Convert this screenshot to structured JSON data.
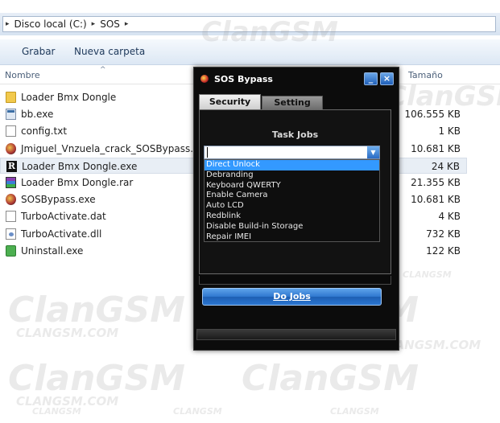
{
  "explorer": {
    "breadcrumb": [
      "Disco local (C:)",
      "SOS"
    ],
    "toolbar": {
      "burn_label": "Grabar",
      "new_folder_label": "Nueva carpeta"
    },
    "columns": {
      "name": "Nombre",
      "size": "Tamaño"
    },
    "files": [
      {
        "name": "Loader Bmx Dongle",
        "size": "",
        "icon": "folder-icon"
      },
      {
        "name": "bb.exe",
        "size": "106.555 KB",
        "icon": "app-icon"
      },
      {
        "name": "config.txt",
        "size": "1 KB",
        "icon": "text-file-icon"
      },
      {
        "name": "Jmiguel_Vnzuela_crack_SOSBypass.exe",
        "size": "10.681 KB",
        "icon": "sosbypass-icon"
      },
      {
        "name": "Loader Bmx Dongle.exe",
        "size": "24 KB",
        "icon": "loader-r-icon"
      },
      {
        "name": "Loader Bmx Dongle.rar",
        "size": "21.355 KB",
        "icon": "rar-archive-icon"
      },
      {
        "name": "SOSBypass.exe",
        "size": "10.681 KB",
        "icon": "sosbypass-icon"
      },
      {
        "name": "TurboActivate.dat",
        "size": "4 KB",
        "icon": "data-file-icon"
      },
      {
        "name": "TurboActivate.dll",
        "size": "732 KB",
        "icon": "dll-file-icon"
      },
      {
        "name": "Uninstall.exe",
        "size": "122 KB",
        "icon": "uninstall-icon"
      }
    ],
    "selected_index": 4
  },
  "watermark": {
    "big": "ClanGSM",
    "small": "CLANGSM.COM",
    "tiny": "CLANGSM"
  },
  "dialog": {
    "title": "SOS Bypass",
    "minimize_glyph": "_",
    "close_glyph": "×",
    "tabs": [
      {
        "label": "Security",
        "active": true
      },
      {
        "label": "Setting",
        "active": false
      }
    ],
    "task_jobs_label": "Task Jobs",
    "combo_value": "",
    "combo_options": [
      "Direct Unlock",
      "Debranding",
      "Keyboard QWERTY",
      "Enable Camera",
      "Auto LCD",
      "Redblink",
      "Disable Build-in Storage",
      "Repair IMEI"
    ],
    "highlighted_option": 0,
    "do_jobs_label": "Do Jobs"
  },
  "colors": {
    "dialog_bg": "#0c0c0c",
    "accent_blue": "#2f77cf",
    "highlight": "#3399ff"
  }
}
